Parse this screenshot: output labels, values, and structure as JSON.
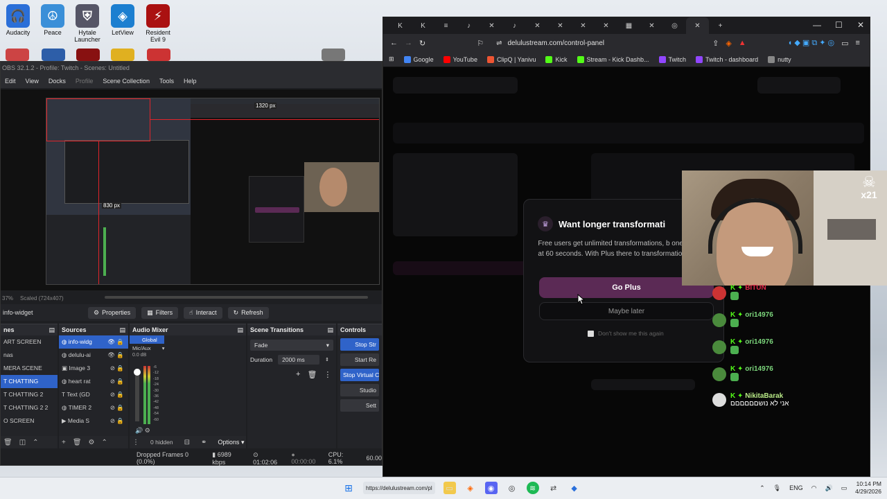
{
  "desktop": {
    "icons": [
      {
        "label": "Audacity",
        "color": "#2b6fd8",
        "glyph": "🎧"
      },
      {
        "label": "Peace",
        "color": "#3a8fd8",
        "glyph": "☮"
      },
      {
        "label": "Hytale Launcher",
        "color": "#556",
        "glyph": "⛨"
      },
      {
        "label": "LetView",
        "color": "#1c7fd0",
        "glyph": "◈"
      },
      {
        "label": "Resident Evil 9",
        "color": "#a11",
        "glyph": "⚡"
      }
    ]
  },
  "obs": {
    "title": "OBS 32.1.2 - Profile: Twitch - Scenes: Untitled",
    "menu": [
      "Edit",
      "View",
      "Docks",
      "Profile",
      "Scene Collection",
      "Tools",
      "Help"
    ],
    "preview": {
      "label_top": "1320 px",
      "label_mid": "830 px",
      "zoom": "37%",
      "scale": "Scaled (724x407)"
    },
    "source_name": "info-widget",
    "toolbar": {
      "properties": "Properties",
      "filters": "Filters",
      "interact": "Interact",
      "refresh": "Refresh"
    },
    "scenes": {
      "title": "nes",
      "items": [
        "ART SCREEN",
        "nas",
        "MERA SCENE",
        "T CHATTING",
        "T CHATTING 2",
        "T CHATTING 2 2",
        "O SCREEN"
      ],
      "selected_index": 3
    },
    "sources": {
      "title": "Sources",
      "items": [
        "info-widg",
        "delulu-ai",
        "Image 3",
        "heart rat",
        "Text (GD",
        "TIMER 2",
        "Media S"
      ]
    },
    "audio": {
      "title": "Audio Mixer",
      "channel_label": "Global",
      "channel_name": "Mic/Aux",
      "db": "0.0 dB",
      "scale": [
        "-6",
        "-12",
        "-18",
        "-24",
        "-30",
        "-36",
        "-42",
        "-48",
        "-54",
        "-60"
      ],
      "hidden": "0 hidden",
      "options": "Options"
    },
    "transitions": {
      "title": "Scene Transitions",
      "type": "Fade",
      "duration_label": "Duration",
      "duration": "2000 ms"
    },
    "controls": {
      "title": "Controls",
      "buttons": [
        "Stop Str",
        "Start Re",
        "Stop Virtual C",
        "Studio",
        "Sett"
      ]
    },
    "status": {
      "dropped": "Dropped Frames 0 (0.0%)",
      "bitrate": "6989 kbps",
      "stream_time": "01:02:06",
      "rec_time": "00:00:00",
      "cpu": "CPU: 6.1%",
      "fps": "60.00"
    }
  },
  "browser": {
    "tabs": [
      "K",
      "K",
      "≡",
      "♪",
      "✕",
      "♪",
      "✕",
      "✕",
      "✕",
      "✕",
      "▦",
      "✕",
      "◎",
      "✕"
    ],
    "new_tab": "+",
    "url": "delulustream.com/control-panel",
    "bookmarks": [
      {
        "label": "Google",
        "color": "#4285f4"
      },
      {
        "label": "YouTube",
        "color": "#ff0000"
      },
      {
        "label": "ClipQ | Yanivu",
        "color": "#e53"
      },
      {
        "label": "Kick",
        "color": "#53fc18"
      },
      {
        "label": "Stream - Kick Dashb...",
        "color": "#53fc18"
      },
      {
        "label": "Twitch",
        "color": "#9146ff"
      },
      {
        "label": "Twitch - dashboard",
        "color": "#9146ff"
      },
      {
        "label": "nutty",
        "color": "#888"
      }
    ]
  },
  "modal": {
    "title": "Want longer transformati",
    "body": "Free users get unlimited transformations, b one is capped at 60 seconds. With Plus there to transformation duration.",
    "go_plus": "Go Plus",
    "maybe_later": "Maybe later",
    "dont_show": "Don't show me this again"
  },
  "cam": {
    "badge_top": "☠",
    "badge_bottom": "x21"
  },
  "chat": {
    "messages": [
      {
        "user": "BITUN",
        "color": "#e02b4a",
        "text": ""
      },
      {
        "user": "ori14976",
        "color": "#7cd67c",
        "text": ""
      },
      {
        "user": "ori14976",
        "color": "#7cd67c",
        "text": ""
      },
      {
        "user": "ori14976",
        "color": "#7cd67c",
        "text": ""
      },
      {
        "user": "NikitaBarak",
        "color": "#b8e986",
        "text": "אני לא נושםםםםםם"
      }
    ]
  },
  "taskbar": {
    "search_text": "https://delulustream.com/pl",
    "lang": "ENG",
    "time": "10:14 PM",
    "date": "4/29/2026"
  }
}
